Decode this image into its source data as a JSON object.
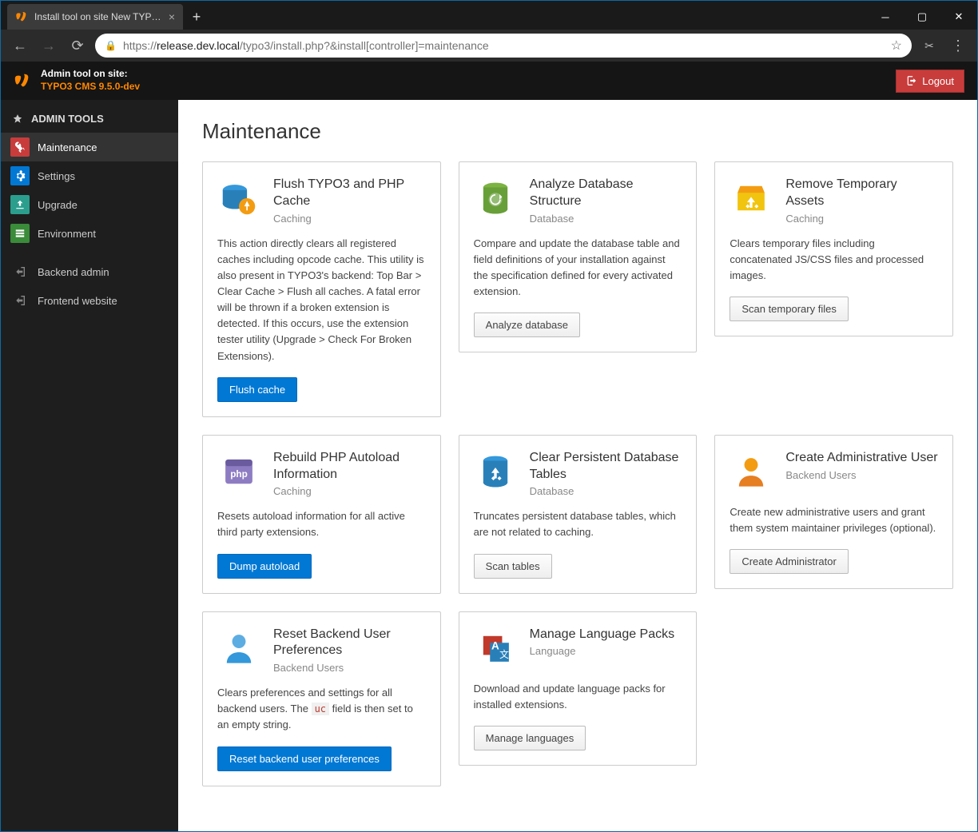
{
  "browser": {
    "tab_title": "Install tool on site New TYPO3 si",
    "url_dark": "release.dev.local",
    "url_rest": "/typo3/install.php?&install[controller]=maintenance",
    "url_prefix": "https://"
  },
  "topbar": {
    "line1": "Admin tool on site:",
    "line2": "TYPO3 CMS 9.5.0-dev",
    "logout": "Logout"
  },
  "sidebar": {
    "header": "ADMIN TOOLS",
    "items": [
      {
        "label": "Maintenance"
      },
      {
        "label": "Settings"
      },
      {
        "label": "Upgrade"
      },
      {
        "label": "Environment"
      }
    ],
    "links": [
      {
        "label": "Backend admin"
      },
      {
        "label": "Frontend website"
      }
    ]
  },
  "page": {
    "title": "Maintenance"
  },
  "cards": [
    {
      "title": "Flush TYPO3 and PHP Cache",
      "category": "Caching",
      "desc": "This action directly clears all registered caches including opcode cache. This utility is also present in TYPO3's backend: Top Bar > Clear Cache > Flush all caches. A fatal error will be thrown if a broken extension is detected. If this occurs, use the extension tester utility (Upgrade > Check For Broken Extensions).",
      "button": "Flush cache",
      "primary": true
    },
    {
      "title": "Analyze Database Structure",
      "category": "Database",
      "desc": "Compare and update the database table and field definitions of your installation against the specification defined for every activated extension.",
      "button": "Analyze database",
      "primary": false
    },
    {
      "title": "Remove Temporary Assets",
      "category": "Caching",
      "desc": "Clears temporary files including concatenated JS/CSS files and processed images.",
      "button": "Scan temporary files",
      "primary": false
    },
    {
      "title": "Rebuild PHP Autoload Information",
      "category": "Caching",
      "desc": "Resets autoload information for all active third party extensions.",
      "button": "Dump autoload",
      "primary": true
    },
    {
      "title": "Clear Persistent Database Tables",
      "category": "Database",
      "desc": "Truncates persistent database tables, which are not related to caching.",
      "button": "Scan tables",
      "primary": false
    },
    {
      "title": "Create Administrative User",
      "category": "Backend Users",
      "desc": "Create new administrative users and grant them system maintainer privileges (optional).",
      "button": "Create Administrator",
      "primary": false
    },
    {
      "title": "Reset Backend User Preferences",
      "category": "Backend Users",
      "desc_html": "Clears preferences and settings for all backend users. The <code>uc</code> field is then set to an empty string.",
      "button": "Reset backend user preferences",
      "primary": true
    },
    {
      "title": "Manage Language Packs",
      "category": "Language",
      "desc": "Download and update language packs for installed extensions.",
      "button": "Manage languages",
      "primary": false
    }
  ]
}
